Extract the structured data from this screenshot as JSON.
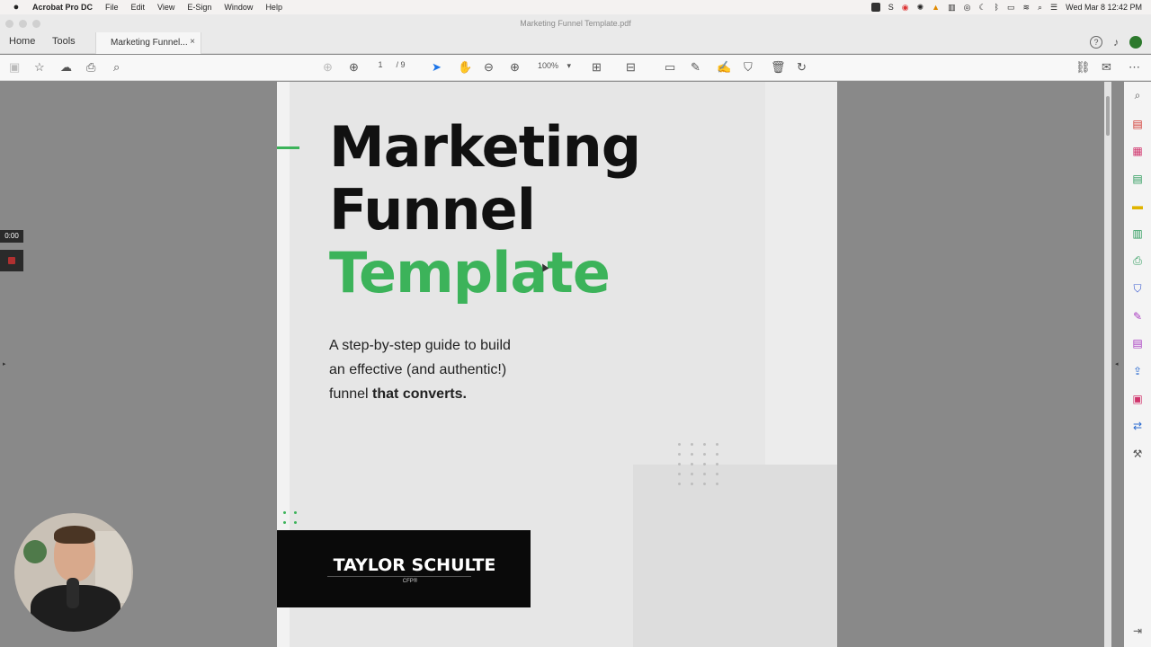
{
  "menubar": {
    "app_name": "Acrobat Pro DC",
    "items": [
      "File",
      "Edit",
      "View",
      "E-Sign",
      "Window",
      "Help"
    ],
    "clock": "Wed Mar 8  12:42 PM"
  },
  "window": {
    "title": "Marketing Funnel Template.pdf"
  },
  "tabs": {
    "home": "Home",
    "tools": "Tools",
    "document": "Marketing Funnel...",
    "close": "×"
  },
  "toolbar": {
    "page_current": "1",
    "page_total": "/ 9",
    "zoom": "100%"
  },
  "document": {
    "title_line1": "Marketing",
    "title_line2": "Funnel",
    "title_line3": "Template",
    "subtitle_line1": "A step-by-step guide to build",
    "subtitle_line2": "an effective (and authentic!)",
    "subtitle_line3_plain": "funnel ",
    "subtitle_line3_bold": "that converts.",
    "author_name": "TAYLOR SCHULTE",
    "author_credential": "CFP®",
    "accent_color": "#3cb35a"
  },
  "recorder": {
    "timer": "0:00"
  },
  "rail_icons": [
    "search-zoom-icon",
    "create-pdf-icon",
    "organize-pages-icon",
    "export-pdf-icon",
    "comment-icon",
    "compress-icon",
    "print-production-icon",
    "protect-icon",
    "fill-sign-icon",
    "edit-pdf-icon",
    "share-icon",
    "combine-icon",
    "convert-icon",
    "more-tools-icon"
  ]
}
